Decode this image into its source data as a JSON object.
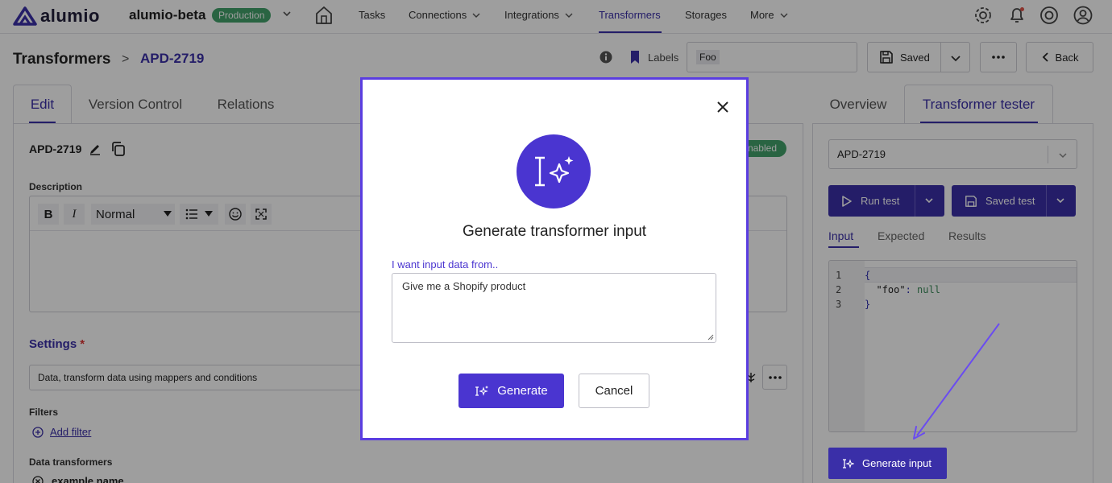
{
  "app": {
    "logo_text": "alumio",
    "environment": "alumio-beta",
    "environment_badge": "Production",
    "colors": {
      "accent": "#3a2fa8",
      "modal_accent": "#4a35d0",
      "badge_green": "#43a26b"
    }
  },
  "nav": {
    "items": [
      {
        "label": "Tasks"
      },
      {
        "label": "Connections"
      },
      {
        "label": "Integrations"
      },
      {
        "label": "Transformers"
      },
      {
        "label": "Storages"
      },
      {
        "label": "More"
      }
    ],
    "active": "Transformers",
    "icons": [
      "home-icon",
      "gear-icon",
      "bell-icon",
      "help-icon",
      "user-icon"
    ]
  },
  "breadcrumb": {
    "title": "Transformers",
    "separator": ">",
    "current": "APD-2719"
  },
  "header_actions": {
    "labels_text": "Labels",
    "label_chip": "Foo",
    "saved_label": "Saved",
    "back_label": "Back"
  },
  "left": {
    "tabs": [
      {
        "label": "Edit"
      },
      {
        "label": "Version Control"
      },
      {
        "label": "Relations"
      }
    ],
    "name": "APD-2719",
    "status": "Enabled",
    "description_label": "Description",
    "toolbar": {
      "bold": "B",
      "italic": "I",
      "format": "Normal"
    },
    "settings_label": "Settings",
    "settings_required": "*",
    "settings_value": "Data, transform data using mappers and conditions",
    "filters_label": "Filters",
    "add_filter": "Add filter",
    "data_transformers_label": "Data transformers",
    "example_name": "example name"
  },
  "right": {
    "tabs": [
      {
        "label": "Overview"
      },
      {
        "label": "Transformer tester"
      }
    ],
    "select_value": "APD-2719",
    "run_test": "Run test",
    "saved_test": "Saved test",
    "subtabs": [
      {
        "label": "Input"
      },
      {
        "label": "Expected"
      },
      {
        "label": "Results"
      }
    ],
    "code_lines": [
      {
        "num": "1",
        "text": "{"
      },
      {
        "num": "2",
        "key": "  \"foo\"",
        "sep": ": ",
        "value": "null"
      },
      {
        "num": "3",
        "text": "}"
      }
    ],
    "generate_input": "Generate input"
  },
  "modal": {
    "title": "Generate transformer input",
    "field_label": "I want input data from..",
    "field_value": "Give me a Shopify product",
    "generate": "Generate",
    "cancel": "Cancel"
  }
}
